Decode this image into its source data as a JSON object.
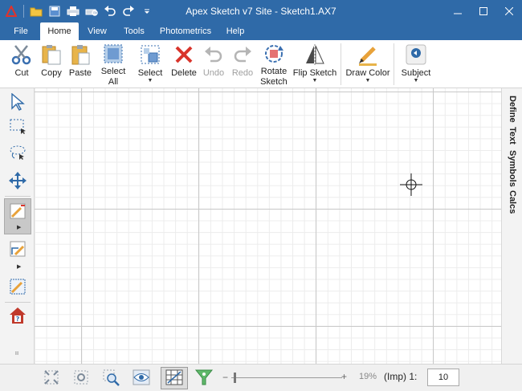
{
  "app": {
    "title": "Apex Sketch v7 Site - Sketch1.AX7"
  },
  "menu_tabs": [
    {
      "label": "File"
    },
    {
      "label": "Home"
    },
    {
      "label": "View"
    },
    {
      "label": "Tools"
    },
    {
      "label": "Photometrics"
    },
    {
      "label": "Help"
    }
  ],
  "active_tab": "Home",
  "ribbon": {
    "cut": "Cut",
    "copy": "Copy",
    "paste": "Paste",
    "select_all_1": "Select",
    "select_all_2": "All",
    "select": "Select",
    "delete": "Delete",
    "undo": "Undo",
    "redo": "Redo",
    "rotate_1": "Rotate",
    "rotate_2": "Sketch",
    "flip": "Flip Sketch",
    "draw_color": "Draw Color",
    "subject": "Subject"
  },
  "right_tabs": [
    "Define",
    "Text",
    "Symbols",
    "Calcs"
  ],
  "status": {
    "zoom_percent": "19%",
    "units": "(Imp) 1:",
    "scale": "10"
  },
  "icons": {
    "accent": "#2f6aa8",
    "delete_color": "#d9342b",
    "home_color": "#c0392b"
  }
}
